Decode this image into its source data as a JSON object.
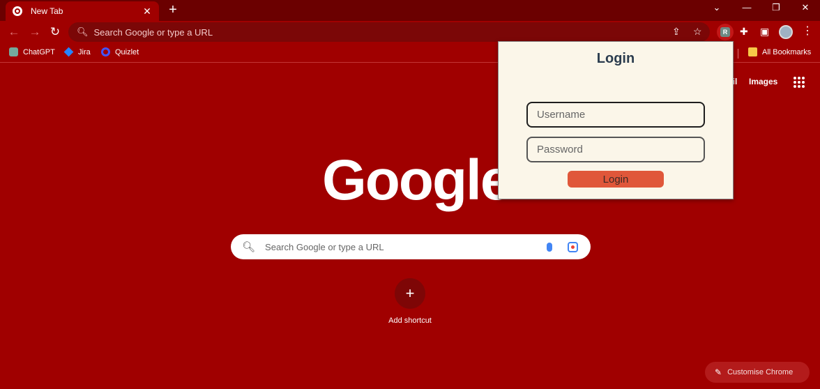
{
  "tab": {
    "title": "New Tab",
    "close": "✕",
    "new": "+"
  },
  "window": {
    "chevron": "⌄",
    "minimize": "—",
    "restore": "❐",
    "close": "✕"
  },
  "toolbar": {
    "back": "←",
    "forward": "→",
    "reload": "↻",
    "omnibox_text": "Search Google or type a URL",
    "share": "⇪",
    "star": "☆",
    "extension_badge": "R",
    "puzzle": "✚",
    "sidepanel": "▣",
    "menu": "⋮"
  },
  "bookmarks": [
    {
      "label": "ChatGPT",
      "icon": "chatgpt-icon"
    },
    {
      "label": "Jira",
      "icon": "jira-icon"
    },
    {
      "label": "Quizlet",
      "icon": "quizlet-icon"
    }
  ],
  "all_bookmarks": "All Bookmarks",
  "ntp": {
    "gmail_partial": "ail",
    "images": "Images",
    "logo": "Google",
    "search_placeholder": "Search Google or type a URL",
    "add_shortcut": "Add shortcut",
    "shortcut_plus": "+",
    "customise": "Customise Chrome"
  },
  "popup": {
    "title": "Login",
    "username_placeholder": "Username",
    "password_placeholder": "Password",
    "button": "Login"
  },
  "colors": {
    "theme": "#a00000",
    "popup_bg": "#fbf6e9",
    "login_button": "#e0573a"
  }
}
